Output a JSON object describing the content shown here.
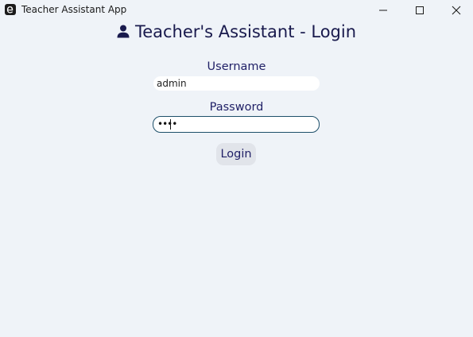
{
  "window": {
    "title": "Teacher Assistant App",
    "icon": "app-e-icon",
    "controls": [
      "minimize-icon",
      "maximize-icon",
      "close-icon"
    ]
  },
  "login": {
    "title": "Teacher's Assistant - Login",
    "title_icon": "user-icon",
    "username_label": "Username",
    "username_value": "admin",
    "password_label": "Password",
    "password_masked": "••••",
    "login_label": "Login"
  },
  "colors": {
    "background": "#eff3f8",
    "text": "#1f1f66",
    "focus_border": "#1d4f6a",
    "button": "#e1e4ea"
  }
}
